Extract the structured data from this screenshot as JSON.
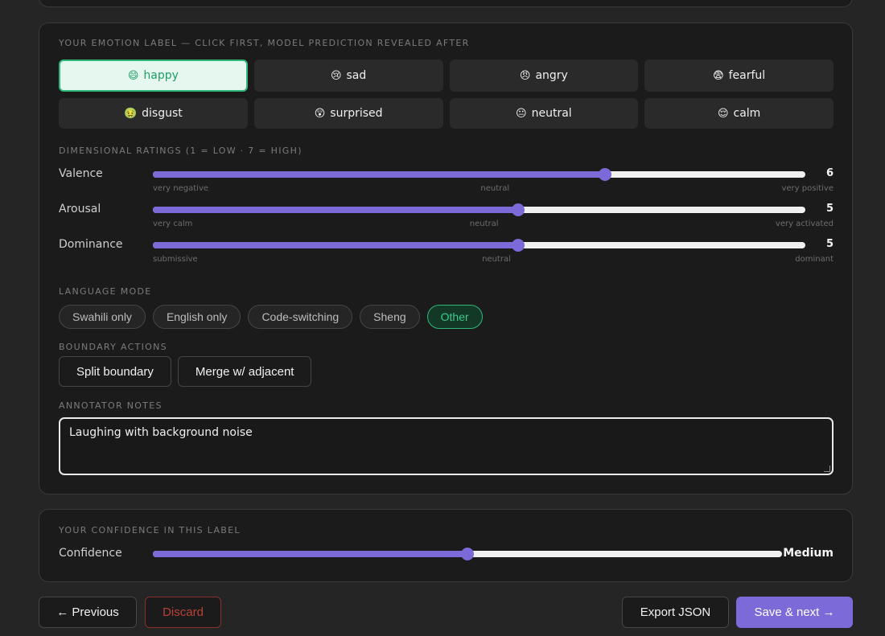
{
  "emotion": {
    "section_label": "YOUR EMOTION LABEL — CLICK FIRST, MODEL PREDICTION REVEALED AFTER",
    "selected": "happy",
    "options": [
      {
        "icon": "😄",
        "label": "happy",
        "icon_name": "grinning-face-icon"
      },
      {
        "icon": "😢",
        "label": "sad",
        "icon_name": "crying-face-icon"
      },
      {
        "icon": "😠",
        "label": "angry",
        "icon_name": "angry-face-icon"
      },
      {
        "icon": "😨",
        "label": "fearful",
        "icon_name": "fearful-face-icon"
      },
      {
        "icon": "🤢",
        "label": "disgust",
        "icon_name": "nauseated-face-icon"
      },
      {
        "icon": "😲",
        "label": "surprised",
        "icon_name": "astonished-face-icon"
      },
      {
        "icon": "😐",
        "label": "neutral",
        "icon_name": "neutral-face-icon"
      },
      {
        "icon": "😌",
        "label": "calm",
        "icon_name": "relieved-face-icon"
      }
    ]
  },
  "dimensions": {
    "section_label": "DIMENSIONAL RATINGS (1 = LOW · 7 = HIGH)",
    "min": 1,
    "max": 7,
    "sliders": [
      {
        "name": "Valence",
        "value": 6,
        "scale": [
          "very negative",
          "neutral",
          "very positive"
        ]
      },
      {
        "name": "Arousal",
        "value": 5,
        "scale": [
          "very calm",
          "neutral",
          "very activated"
        ]
      },
      {
        "name": "Dominance",
        "value": 5,
        "scale": [
          "submissive",
          "neutral",
          "dominant"
        ]
      }
    ]
  },
  "language": {
    "section_label": "LANGUAGE MODE",
    "selected": "Other",
    "options": [
      "Swahili only",
      "English only",
      "Code-switching",
      "Sheng",
      "Other"
    ]
  },
  "boundary": {
    "section_label": "BOUNDARY ACTIONS",
    "split_label": "Split boundary",
    "merge_label": "Merge w/ adjacent"
  },
  "notes": {
    "section_label": "ANNOTATOR NOTES",
    "value": "Laughing with background noise"
  },
  "confidence": {
    "section_label": "YOUR CONFIDENCE IN THIS LABEL",
    "name": "Confidence",
    "level": 0.5,
    "value_label": "Medium"
  },
  "footer": {
    "previous_label": "← Previous",
    "discard_label": "Discard",
    "export_label": "Export JSON",
    "save_label": "Save & next →"
  },
  "colors": {
    "accent": "#7c6ad8",
    "selected_green": "#2fb879",
    "danger": "#b84236",
    "background": "#262526",
    "card": "#1c1b1c"
  }
}
